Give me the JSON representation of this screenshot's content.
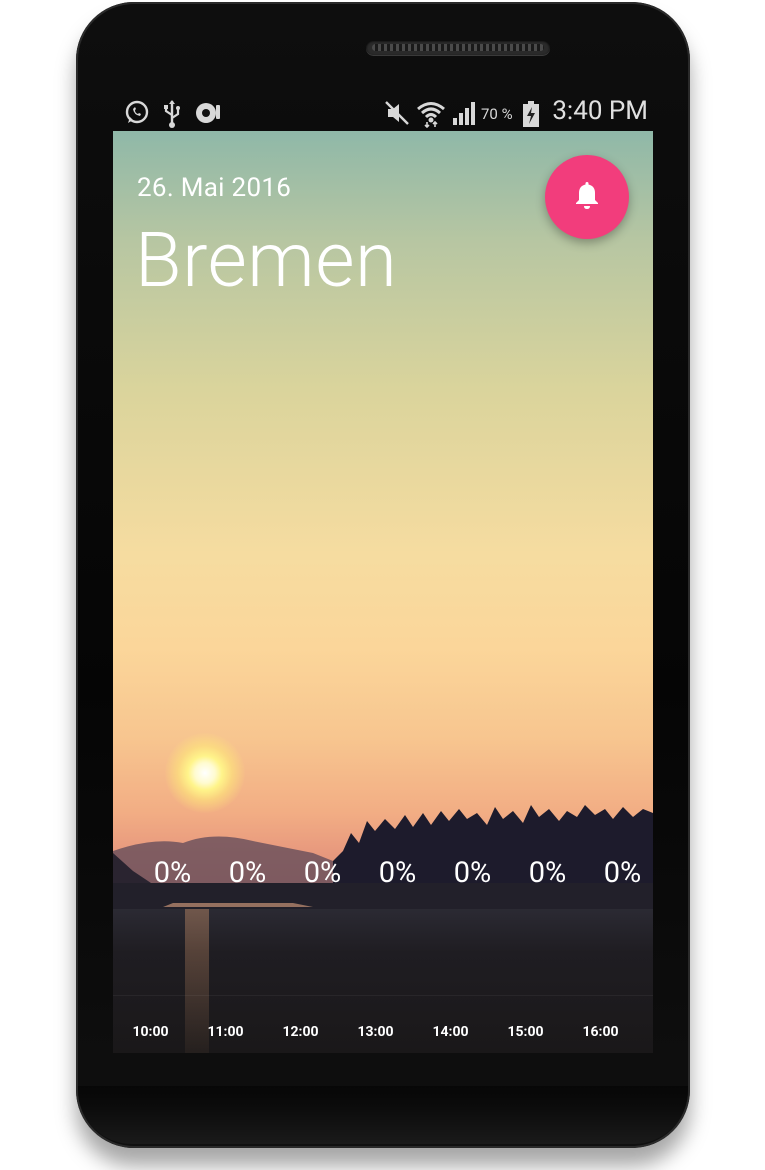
{
  "statusbar": {
    "battery_pct": "70 %",
    "time": "3:40 PM",
    "icons": [
      "whatsapp-icon",
      "usb-icon",
      "voicemail-icon",
      "mute-icon",
      "wifi-icon",
      "signal-icon",
      "battery-charging-icon"
    ]
  },
  "weather": {
    "date": "26. Mai 2016",
    "city": "Bremen",
    "alarm_button_icon": "bell-icon",
    "accent_color": "#f23d7c"
  },
  "forecast": {
    "precip": [
      "0%",
      "0%",
      "0%",
      "0%",
      "0%",
      "0%",
      "0%"
    ],
    "hours": [
      "10:00",
      "11:00",
      "12:00",
      "13:00",
      "14:00",
      "15:00",
      "16:00"
    ]
  }
}
